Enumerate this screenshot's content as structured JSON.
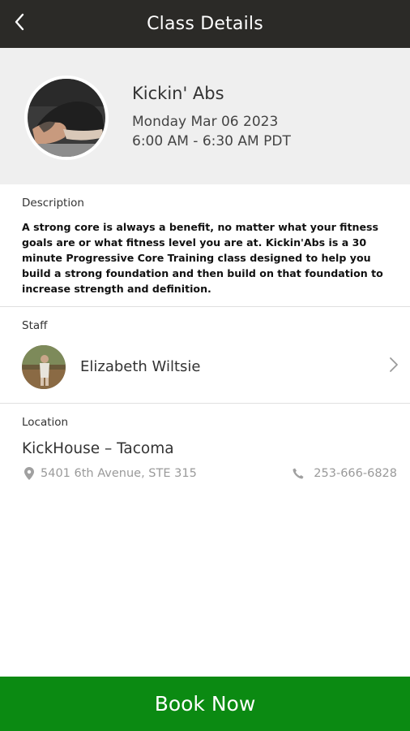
{
  "header": {
    "title": "Class Details",
    "back_icon": "chevron-left-icon"
  },
  "class_info": {
    "name": "Kickin' Abs",
    "date": "Monday Mar 06 2023",
    "time": "6:00 AM - 6:30 AM PDT"
  },
  "description": {
    "label": "Description",
    "text": "A strong core is always a benefit, no matter what your fitness goals are or what fitness level you are at. Kickin'Abs is a 30 minute Progressive Core Training class designed to help you build a strong foundation and then build on that foundation to increase strength and definition."
  },
  "staff": {
    "label": "Staff",
    "name": "Elizabeth Wiltsie"
  },
  "location": {
    "label": "Location",
    "name": "KickHouse – Tacoma",
    "address": "5401 6th Avenue, STE 315",
    "phone": "253-666-6828"
  },
  "actions": {
    "book_label": "Book Now"
  },
  "colors": {
    "header_bg": "#2b2a27",
    "hero_bg": "#efefef",
    "accent_green": "#0b8a12"
  }
}
